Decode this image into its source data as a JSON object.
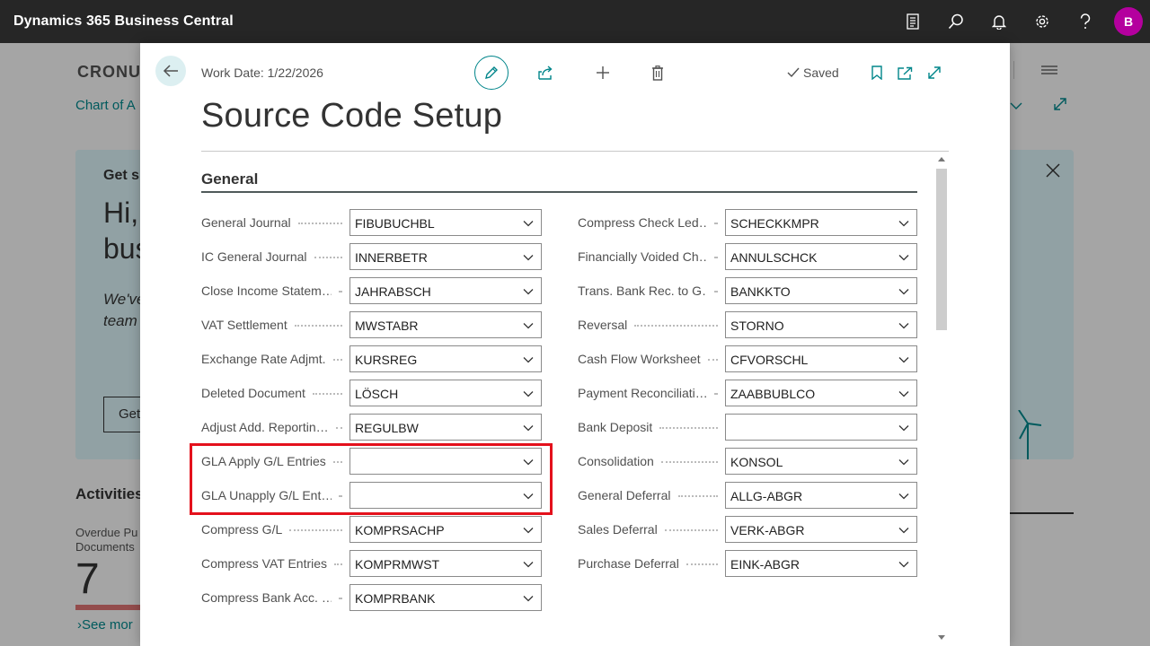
{
  "appbar": {
    "title": "Dynamics 365 Business Central",
    "avatar_initial": "B",
    "avatar_color": "#b4009e",
    "icons": [
      "document-icon",
      "search-icon",
      "bell-icon",
      "gear-icon",
      "help-icon"
    ]
  },
  "background": {
    "company": "CRONU",
    "nav_item": "Chart of A",
    "hero_heading": "Get s",
    "hero_greeting_line1": "Hi,",
    "hero_greeting_line2": "bus",
    "hero_text_line1": "We've",
    "hero_text_line2": "team",
    "hero_button": "Get",
    "activities": "Activities",
    "overdue_line1": "Overdue Pu",
    "overdue_line2": "Documents",
    "overdue_count": "7",
    "see_more": "See mor"
  },
  "dialog": {
    "work_date": "Work Date: 1/22/2026",
    "saved_label": "Saved",
    "title": "Source Code Setup",
    "section": "General",
    "left_fields": [
      {
        "label": "General Journal",
        "value": "FIBUBUCHBL"
      },
      {
        "label": "IC General Journal",
        "value": "INNERBETR"
      },
      {
        "label": "Close Income Statem…",
        "value": "JAHRABSCH"
      },
      {
        "label": "VAT Settlement",
        "value": "MWSTABR"
      },
      {
        "label": "Exchange Rate Adjmt.",
        "value": "KURSREG"
      },
      {
        "label": "Deleted Document",
        "value": "LÖSCH"
      },
      {
        "label": "Adjust Add. Reportin…",
        "value": "REGULBW"
      },
      {
        "label": "GLA Apply G/L Entries",
        "value": ""
      },
      {
        "label": "GLA Unapply G/L Ent…",
        "value": ""
      },
      {
        "label": "Compress G/L",
        "value": "KOMPRSACHP"
      },
      {
        "label": "Compress VAT Entries",
        "value": "KOMPRMWST"
      },
      {
        "label": "Compress Bank Acc. …",
        "value": "KOMPRBANK"
      }
    ],
    "right_fields": [
      {
        "label": "Compress Check Led…",
        "value": "SCHECKKMPR"
      },
      {
        "label": "Financially Voided Ch…",
        "value": "ANNULSCHCK"
      },
      {
        "label": "Trans. Bank Rec. to G…",
        "value": "BANKKTO"
      },
      {
        "label": "Reversal",
        "value": "STORNO"
      },
      {
        "label": "Cash Flow Worksheet",
        "value": "CFVORSCHL"
      },
      {
        "label": "Payment Reconciliati…",
        "value": "ZAABBUBLCO"
      },
      {
        "label": "Bank Deposit",
        "value": ""
      },
      {
        "label": "Consolidation",
        "value": "KONSOL"
      },
      {
        "label": "General Deferral",
        "value": "ALLG-ABGR"
      },
      {
        "label": "Sales Deferral",
        "value": "VERK-ABGR"
      },
      {
        "label": "Purchase Deferral",
        "value": "EINK-ABGR"
      }
    ]
  },
  "colors": {
    "accent": "#00858a",
    "highlight": "#e4111c"
  }
}
